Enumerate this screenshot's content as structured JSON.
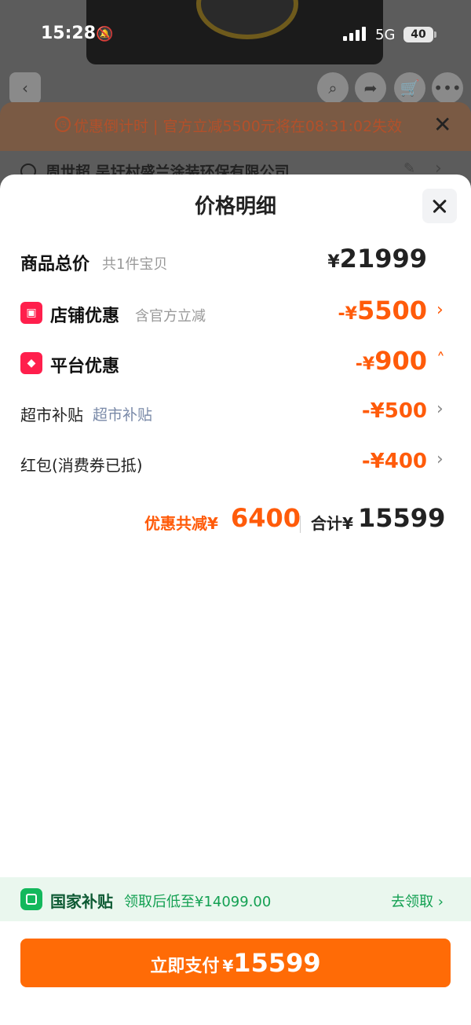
{
  "status_bar": {
    "time": "15:28",
    "network": "5G",
    "battery": "40"
  },
  "background": {
    "promo_text": "优惠倒计时 | 官方立减5500元将在08:31:02失效",
    "address": "周世超 吴圩村盛兰涂装环保有限公司"
  },
  "sheet": {
    "title": "价格明细",
    "rows": {
      "goods_total": {
        "label": "商品总价",
        "sub": "共1件宝贝",
        "currency": "¥",
        "amount": "21999"
      },
      "store_discount": {
        "label": "店铺优惠",
        "sub": "含官方立减",
        "prefix": "-¥",
        "amount": "5500"
      },
      "platform_discount": {
        "label": "平台优惠",
        "prefix": "-¥",
        "amount": "900"
      },
      "supermarket": {
        "label": "超市补贴",
        "sub": "超市补贴",
        "amount": "-¥500"
      },
      "red_packet": {
        "label": "红包(消费券已抵)",
        "amount": "-¥400"
      }
    },
    "summary": {
      "discount_label": "优惠共减¥",
      "discount_amount": "6400",
      "total_label": "合计¥",
      "total_amount": "15599"
    }
  },
  "subsidy": {
    "title": "国家补贴",
    "text": "领取后低至¥14099.00",
    "link": "去领取 ›"
  },
  "pay_button": {
    "label": "立即支付",
    "currency": "¥",
    "amount": "15599"
  }
}
